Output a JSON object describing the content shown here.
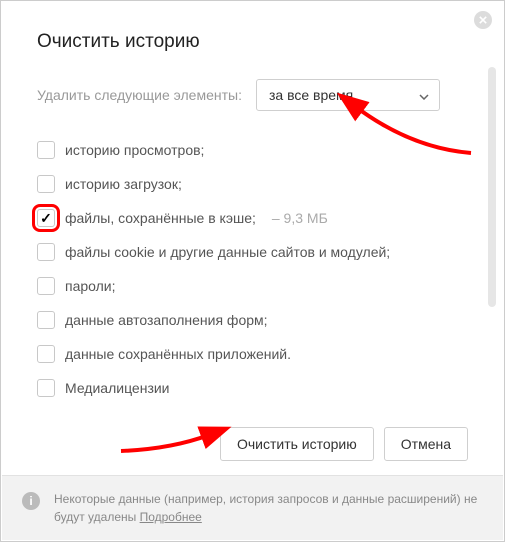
{
  "title": "Очистить историю",
  "delete_label": "Удалить следующие элементы:",
  "time_range": {
    "selected": "за все время"
  },
  "options": [
    {
      "label": "историю просмотров;",
      "checked": false,
      "highlighted": false
    },
    {
      "label": "историю загрузок;",
      "checked": false,
      "highlighted": false
    },
    {
      "label": "файлы, сохранённые в кэше;",
      "checked": true,
      "highlighted": true,
      "size_prefix": "–",
      "size": "9,3 МБ"
    },
    {
      "label": "файлы cookie и другие данные сайтов и модулей;",
      "checked": false,
      "highlighted": false
    },
    {
      "label": "пароли;",
      "checked": false,
      "highlighted": false
    },
    {
      "label": "данные автозаполнения форм;",
      "checked": false,
      "highlighted": false
    },
    {
      "label": "данные сохранённых приложений.",
      "checked": false,
      "highlighted": false
    },
    {
      "label": "Медиалицензии",
      "checked": false,
      "highlighted": false
    }
  ],
  "buttons": {
    "clear": "Очистить историю",
    "cancel": "Отмена"
  },
  "footer": {
    "text": "Некоторые данные (например, история запросов и данные расширений) не будут удалены ",
    "link": "Подробнее"
  },
  "info_glyph": "i"
}
